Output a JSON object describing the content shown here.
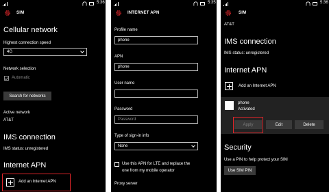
{
  "status": {
    "time_1": "5:36",
    "time_2": "5:35",
    "time_3": "5:36"
  },
  "panel1": {
    "app_title": "SIM",
    "cellular_heading": "Cellular network",
    "speed_label": "Highest connection speed",
    "speed_value": "4G",
    "network_sel_label": "Network selection",
    "automatic_label": "Automatic",
    "search_button": "Search for networks",
    "active_network_label": "Active network",
    "active_network_value": "AT&T",
    "ims_heading": "IMS connection",
    "ims_status": "IMS status: unregistered",
    "apn_heading": "Internet APN",
    "add_apn": "Add an Internet APN"
  },
  "panel2": {
    "app_title": "INTERNET APN",
    "profile_name_label": "Profile name",
    "profile_name_value": "phone",
    "apn_label": "APN",
    "apn_value": "phone",
    "user_name_label": "User name",
    "user_name_value": "",
    "password_label": "Password",
    "password_placeholder": "Password",
    "signin_label": "Type of sign-in info",
    "signin_value": "None",
    "lte_line1": "Use this APN for LTE and replace the",
    "lte_line2": "one from my mobile operator",
    "proxy_label": "Proxy server"
  },
  "panel3": {
    "app_title": "SIM",
    "carrier": "AT&T",
    "ims_heading": "IMS connection",
    "ims_status": "IMS status: unregistered",
    "apn_heading": "Internet APN",
    "add_apn": "Add an Internet APN",
    "apn_name": "phone",
    "apn_state": "Activated",
    "apply_button": "Apply",
    "edit_button": "Edit",
    "delete_button": "Delete",
    "security_heading": "Security",
    "security_desc": "Use a PIN to help protect your SIM",
    "use_pin_button": "Use SIM PIN"
  },
  "colors": {
    "accent_red": "#e0262a",
    "background": "#000000",
    "button": "#3a3a3a"
  },
  "icons": [
    "signal-icon",
    "wifi-icon",
    "battery-icon",
    "sim-gear-icon",
    "plus-icon",
    "chevron-down-icon",
    "checkbox-icon"
  ]
}
